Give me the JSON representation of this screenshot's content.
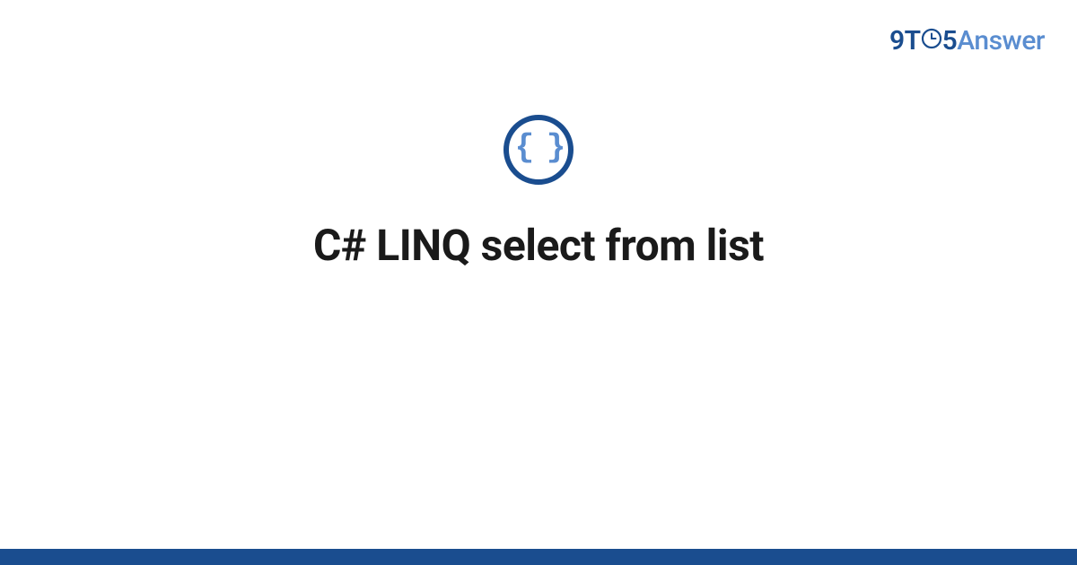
{
  "brand": {
    "nine_t": "9T",
    "five": "5",
    "answer": "Answer"
  },
  "icon": {
    "ring_color": "#1a4d8f",
    "braces_color": "#5a8dd0",
    "braces_text": "{ }"
  },
  "title": "C# LINQ select from list",
  "footer_bar_color": "#1a4d8f"
}
